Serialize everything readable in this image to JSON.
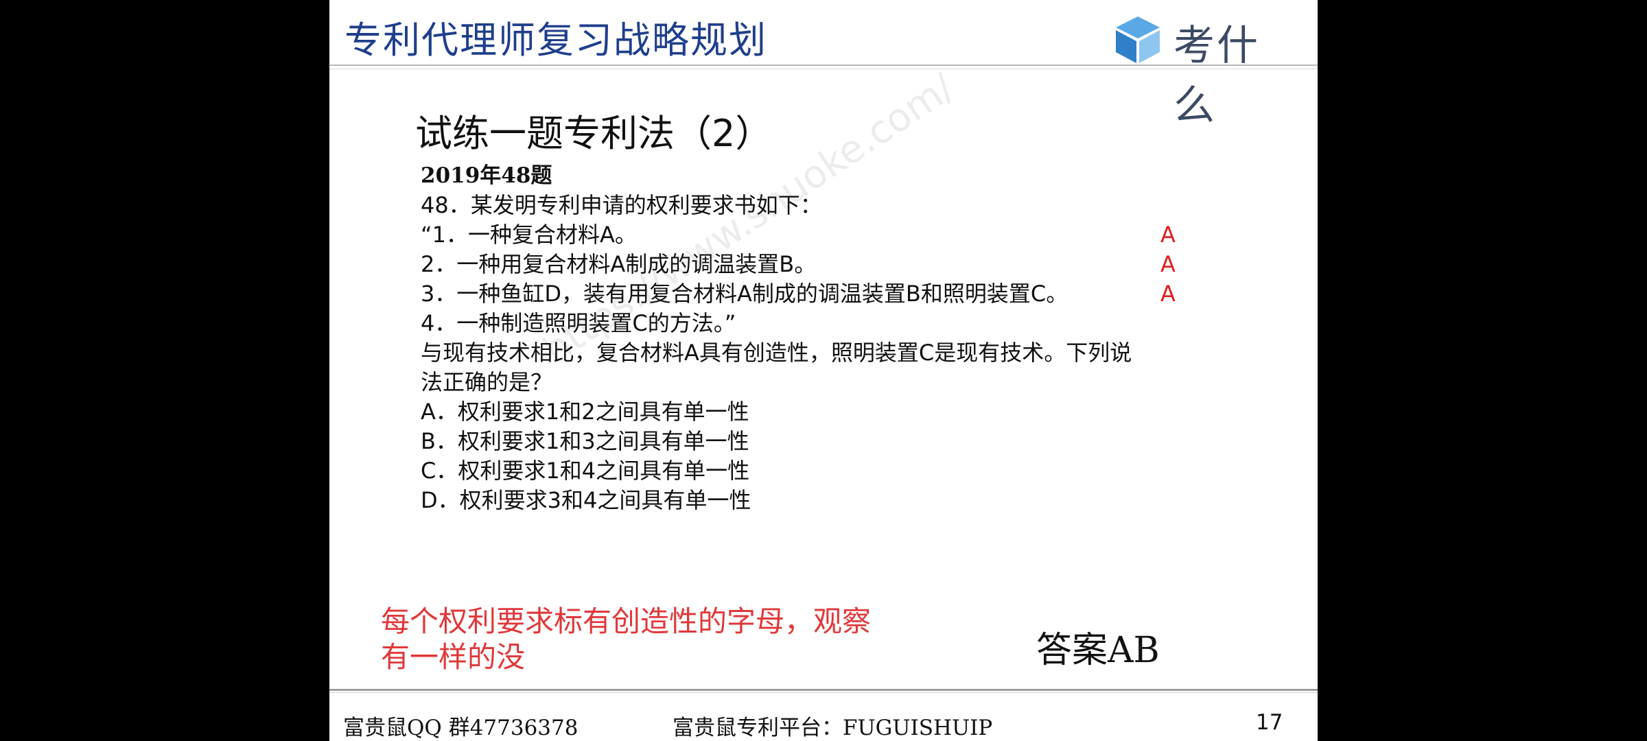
{
  "header": {
    "title": "专利代理师复习战略规划",
    "logo_text": "考什么",
    "logo_icon": "cube-logo-icon"
  },
  "slide": {
    "section_title": "试练一题专利法（2）",
    "year_label": "2019年48题",
    "question_line": "48．某发明专利申请的权利要求书如下：",
    "claims": [
      {
        "text": "“1．一种复合材料A。",
        "mark": "A"
      },
      {
        "text": "2．一种用复合材料A制成的调温装置B。",
        "mark": "A"
      },
      {
        "text": "3．一种鱼缸D，装有用复合材料A制成的调温装置B和照明装置C。",
        "mark": "A"
      },
      {
        "text": "4．一种制造照明装置C的方法。”",
        "mark": ""
      }
    ],
    "stem_line1": "与现有技术相比，复合材料A具有创造性，照明装置C是现有技术。下列说",
    "stem_line2": "法正确的是？",
    "options": [
      "A．权利要求1和2之间具有单一性",
      "B．权利要求1和3之间具有单一性",
      "C．权利要求1和4之间具有单一性",
      "D．权利要求3和4之间具有单一性"
    ],
    "watermark": "https://www.shuoke.com/",
    "note_line1": "每个权利要求标有创造性的字母，观察",
    "note_line2": "有一样的没",
    "answer": "答案AB"
  },
  "footer": {
    "qq_group": "富贵鼠QQ 群47736378",
    "platform": "富贵鼠专利平台：FUGUISHUIP",
    "page_number": "17"
  },
  "colors": {
    "title_blue": "#1f3f8c",
    "mark_red": "#e41c1c",
    "note_red": "#e0383a",
    "background": "#000000"
  }
}
